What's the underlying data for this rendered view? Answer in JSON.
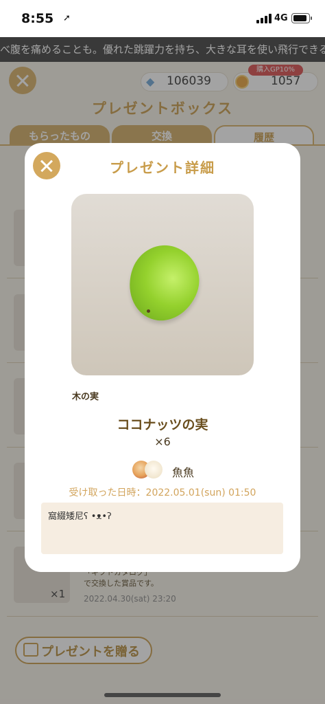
{
  "status_bar": {
    "time": "8:55",
    "network": "4G"
  },
  "ticker": {
    "text": "べ腹を痛めることも。優れた跳躍力を持ち、大きな耳を使い飛行できる"
  },
  "header": {
    "gems": "106039",
    "coins": "1057",
    "gp_badge": "購入GP10%",
    "title": "プレゼントボックス"
  },
  "tabs": [
    {
      "label": "もらったもの"
    },
    {
      "label": "交換"
    },
    {
      "label": "履歴"
    }
  ],
  "background_list": {
    "last_row": {
      "quantity": "×1",
      "note_line1": "「ギフトカタログ」",
      "note_line2": "で交換した賞品です。",
      "date": "2022.04.30(sat) 23:20"
    }
  },
  "footer": {
    "gift_button": "プレゼントを贈る"
  },
  "modal": {
    "title": "プレゼント詳細",
    "category": "木の実",
    "item_name": "ココナッツの実",
    "quantity": "×6",
    "sender": "魚魚",
    "received": "受け取った日時：2022.05.01(sun) 01:50",
    "message": "窩綴矮尼ʕ •ᴥ•ʔ"
  },
  "colors": {
    "accent": "#c89c4a",
    "close": "#d3a85d",
    "message_bg": "#f6ede1"
  }
}
